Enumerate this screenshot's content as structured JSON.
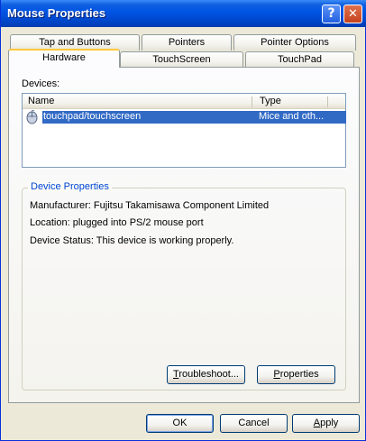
{
  "window": {
    "title": "Mouse Properties"
  },
  "titlebar": {
    "help_glyph": "?",
    "close_glyph": "✕"
  },
  "tabs": {
    "row1": [
      {
        "label": "Tap and Buttons"
      },
      {
        "label": "Pointers"
      },
      {
        "label": "Pointer Options"
      }
    ],
    "row2": [
      {
        "label": "Hardware",
        "active": true
      },
      {
        "label": "TouchScreen"
      },
      {
        "label": "TouchPad"
      }
    ]
  },
  "devices": {
    "label": "Devices:",
    "columns": [
      "Name",
      "Type"
    ],
    "rows": [
      {
        "name": "touchpad/touchscreen",
        "type": "Mice and oth...",
        "icon": "mouse-icon",
        "selected": true
      }
    ]
  },
  "device_properties": {
    "legend": "Device Properties",
    "manufacturer": "Manufacturer: Fujitsu Takamisawa Component Limited",
    "location": "Location: plugged into PS/2 mouse port",
    "status": "Device Status: This device is working properly."
  },
  "buttons": {
    "troubleshoot": {
      "accel": "T",
      "rest": "roubleshoot..."
    },
    "properties": {
      "accel": "P",
      "rest": "roperties"
    },
    "ok": "OK",
    "cancel": "Cancel",
    "apply": {
      "accel": "A",
      "rest": "pply"
    }
  },
  "colors": {
    "titlebar": "#0054e3",
    "selection": "#316ac5",
    "active_tab_accent": "#ffc83c",
    "legend_text": "#0046d5"
  }
}
